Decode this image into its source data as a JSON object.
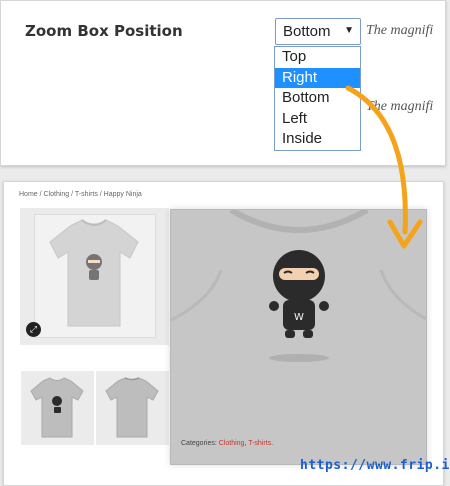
{
  "settings": {
    "label": "Zoom Box Position",
    "select": {
      "value": "Bottom",
      "arrow": "▼",
      "hint_1": "The magnifi",
      "hint_2": "The magnifi",
      "options": [
        "Top",
        "Right",
        "Bottom",
        "Left",
        "Inside"
      ],
      "highlighted_option": "Right"
    }
  },
  "product": {
    "breadcrumb": "Home / Clothing / T-shirts / Happy Ninja",
    "categories_prefix": "Categories:",
    "categories": [
      "Clothing",
      "T-shirts"
    ],
    "magnify_icon": "magnify-icon"
  },
  "colors": {
    "selected_option": "#1e90ff",
    "arrow": "#f5a31a",
    "category_link": "#c0392b",
    "url": "#1a5fd0"
  },
  "watermark": {
    "url": "https://www.frip.in"
  }
}
